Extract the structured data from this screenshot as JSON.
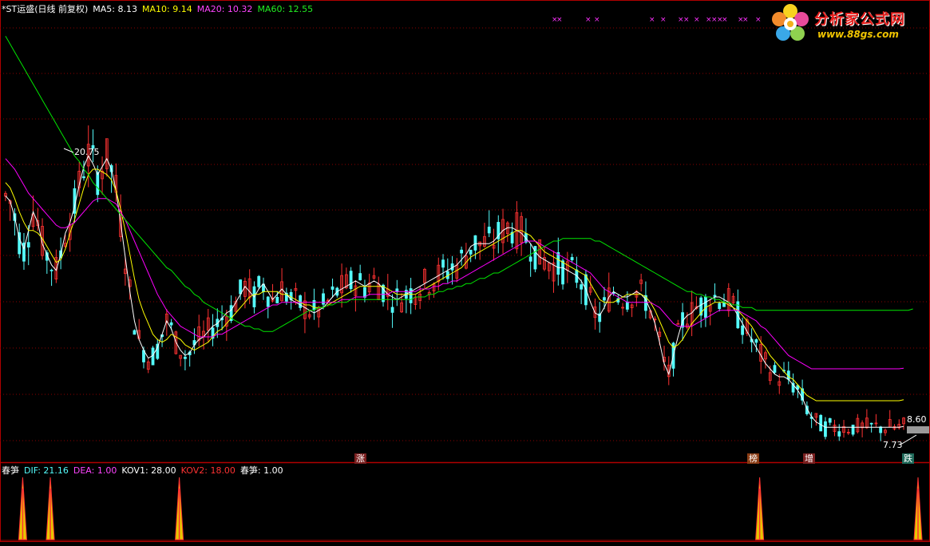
{
  "header": {
    "stock": "*ST运盛(日线 前复权)",
    "ma5": "MA5: 8.13",
    "ma10": "MA10: 9.14",
    "ma20": "MA20: 10.32",
    "ma60": "MA60: 12.55"
  },
  "indicator_header": {
    "name": "春笋",
    "dif": "DIF: 21.16",
    "dea": "DEA: 1.00",
    "kov1": "KOV1: 28.00",
    "kov2": "KOV2: 18.00",
    "chunsun": "春笋: 1.00"
  },
  "logo": {
    "title": "分析家公式网",
    "url": "www.88gs.com"
  },
  "markers": {
    "zhang": "涨",
    "bang": "榜",
    "zeng": "增",
    "die": "跌"
  },
  "colors": {
    "up": "#ff3232",
    "down": "#54fcfc",
    "ma5": "#ffffff",
    "ma10": "#ffff00",
    "ma20": "#ff00ff",
    "ma60": "#00e600",
    "grid": "#8b0000",
    "border": "#b00000"
  },
  "chart_data": {
    "type": "line",
    "price_labels": {
      "high": "20.75",
      "low": "7.73",
      "last": "8.60"
    },
    "ylim": [
      7.3,
      23.5
    ],
    "n_bars": 200,
    "series": [
      {
        "name": "MA5",
        "values": [
          16.8,
          16.6,
          16.0,
          15.2,
          14.8,
          15.5,
          16.2,
          15.8,
          15.0,
          14.6,
          14.2,
          14.0,
          14.6,
          15.4,
          15.8,
          16.4,
          17.2,
          17.9,
          18.3,
          18.0,
          17.6,
          17.9,
          18.2,
          17.8,
          17.0,
          15.8,
          14.5,
          13.2,
          12.1,
          11.4,
          11.0,
          10.7,
          10.8,
          11.1,
          11.6,
          12.1,
          11.8,
          11.3,
          11.0,
          10.8,
          10.9,
          11.2,
          11.4,
          11.5,
          11.7,
          11.9,
          12.0,
          12.2,
          12.4,
          12.5,
          12.8,
          13.1,
          13.4,
          13.2,
          13.0,
          13.3,
          13.5,
          13.2,
          12.9,
          13.1,
          13.3,
          13.1,
          12.9,
          12.8,
          12.7,
          12.6,
          12.5,
          12.4,
          12.5,
          12.6,
          12.8,
          13.0,
          13.2,
          13.3,
          13.4,
          13.5,
          13.6,
          13.5,
          13.4,
          13.5,
          13.6,
          13.5,
          13.3,
          13.1,
          13.0,
          12.9,
          13.0,
          13.1,
          13.2,
          13.3,
          13.4,
          13.5,
          13.6,
          13.7,
          13.8,
          13.9,
          14.0,
          14.1,
          14.2,
          14.4,
          14.6,
          14.9,
          15.0,
          15.0,
          15.0,
          15.0,
          15.1,
          15.3,
          15.5,
          15.6,
          15.6,
          15.5,
          15.4,
          15.2,
          15.0,
          14.7,
          14.5,
          14.4,
          14.3,
          14.2,
          14.1,
          14.1,
          14.0,
          13.9,
          13.8,
          13.6,
          13.3,
          12.8,
          12.4,
          12.3,
          12.6,
          13.0,
          13.2,
          13.1,
          13.0,
          13.0,
          13.1,
          13.2,
          13.1,
          12.9,
          12.5,
          12.0,
          11.3,
          10.5,
          10.1,
          10.8,
          11.5,
          12.1,
          12.3,
          12.4,
          12.6,
          12.7,
          12.8,
          12.9,
          13.0,
          13.0,
          12.9,
          12.8,
          12.6,
          12.3,
          12.0,
          11.7,
          11.4,
          11.1,
          10.8,
          10.5,
          10.3,
          10.1,
          10.0,
          10.0,
          9.9,
          9.7,
          9.5,
          9.2,
          8.8,
          8.5,
          8.3,
          8.2,
          8.1,
          8.1,
          8.1,
          8.1,
          8.1,
          8.1,
          8.1,
          8.1,
          8.1,
          8.1,
          8.1,
          8.1,
          8.1,
          8.1,
          8.1,
          8.1,
          8.1,
          8.13
        ]
      },
      {
        "name": "MA10",
        "values": [
          17.3,
          17.1,
          16.7,
          16.2,
          15.8,
          15.5,
          15.5,
          15.4,
          15.2,
          14.9,
          14.6,
          14.3,
          14.4,
          14.8,
          15.4,
          15.9,
          16.5,
          17.1,
          17.6,
          17.8,
          17.8,
          17.7,
          17.6,
          17.4,
          17.0,
          16.3,
          15.5,
          14.6,
          13.7,
          12.9,
          12.4,
          12.0,
          11.6,
          11.4,
          11.3,
          11.4,
          11.6,
          11.5,
          11.4,
          11.2,
          11.1,
          11.0,
          11.1,
          11.2,
          11.3,
          11.5,
          11.7,
          11.8,
          12.0,
          12.2,
          12.4,
          12.6,
          12.8,
          13.0,
          13.1,
          13.1,
          13.2,
          13.2,
          13.2,
          13.2,
          13.1,
          13.1,
          13.0,
          12.9,
          12.8,
          12.7,
          12.7,
          12.6,
          12.6,
          12.6,
          12.7,
          12.8,
          12.9,
          13.0,
          13.1,
          13.2,
          13.3,
          13.4,
          13.4,
          13.4,
          13.4,
          13.4,
          13.4,
          13.3,
          13.2,
          13.1,
          13.1,
          13.1,
          13.1,
          13.1,
          13.2,
          13.3,
          13.4,
          13.5,
          13.6,
          13.7,
          13.8,
          13.9,
          14.0,
          14.1,
          14.3,
          14.5,
          14.6,
          14.7,
          14.8,
          14.9,
          15.0,
          15.1,
          15.2,
          15.3,
          15.4,
          15.5,
          15.5,
          15.4,
          15.3,
          15.1,
          14.9,
          14.7,
          14.6,
          14.5,
          14.4,
          14.3,
          14.2,
          14.1,
          14.0,
          13.9,
          13.8,
          13.5,
          13.2,
          12.9,
          12.8,
          12.8,
          12.8,
          12.9,
          13.0,
          13.1,
          13.1,
          13.1,
          13.1,
          13.0,
          12.8,
          12.5,
          12.1,
          11.7,
          11.3,
          11.1,
          11.2,
          11.4,
          11.7,
          12.0,
          12.2,
          12.4,
          12.6,
          12.7,
          12.8,
          12.8,
          12.8,
          12.7,
          12.6,
          12.5,
          12.3,
          12.1,
          11.9,
          11.6,
          11.3,
          11.1,
          10.8,
          10.6,
          10.4,
          10.2,
          10.0,
          9.9,
          9.7,
          9.5,
          9.3,
          9.2,
          9.1,
          9.1,
          9.1,
          9.1,
          9.1,
          9.1,
          9.1,
          9.1,
          9.1,
          9.1,
          9.1,
          9.1,
          9.1,
          9.1,
          9.1,
          9.1,
          9.1,
          9.1,
          9.1,
          9.14
        ]
      },
      {
        "name": "MA20",
        "values": [
          18.2,
          18.0,
          17.8,
          17.5,
          17.2,
          16.9,
          16.7,
          16.5,
          16.3,
          16.1,
          15.9,
          15.7,
          15.6,
          15.6,
          15.7,
          15.8,
          16.0,
          16.2,
          16.4,
          16.6,
          16.7,
          16.7,
          16.7,
          16.6,
          16.5,
          16.2,
          15.9,
          15.5,
          15.1,
          14.7,
          14.3,
          13.9,
          13.5,
          13.1,
          12.8,
          12.5,
          12.3,
          12.1,
          11.9,
          11.8,
          11.7,
          11.6,
          11.5,
          11.5,
          11.5,
          11.5,
          11.6,
          11.6,
          11.7,
          11.8,
          11.9,
          12.0,
          12.1,
          12.2,
          12.3,
          12.4,
          12.5,
          12.6,
          12.7,
          12.7,
          12.8,
          12.8,
          12.8,
          12.8,
          12.8,
          12.8,
          12.8,
          12.8,
          12.8,
          12.8,
          12.8,
          12.8,
          12.8,
          12.9,
          12.9,
          12.9,
          13.0,
          13.0,
          13.0,
          13.1,
          13.1,
          13.1,
          13.1,
          13.1,
          13.2,
          13.2,
          13.2,
          13.2,
          13.2,
          13.2,
          13.3,
          13.3,
          13.3,
          13.4,
          13.4,
          13.5,
          13.5,
          13.6,
          13.6,
          13.7,
          13.8,
          13.9,
          14.0,
          14.1,
          14.2,
          14.3,
          14.4,
          14.5,
          14.6,
          14.7,
          14.8,
          14.9,
          15.0,
          15.1,
          15.1,
          15.1,
          15.0,
          14.9,
          14.8,
          14.7,
          14.6,
          14.5,
          14.4,
          14.3,
          14.2,
          14.1,
          14.0,
          13.9,
          13.7,
          13.5,
          13.3,
          13.2,
          13.1,
          13.0,
          12.9,
          12.8,
          12.8,
          12.8,
          12.8,
          12.8,
          12.8,
          12.7,
          12.6,
          12.4,
          12.2,
          12.0,
          11.9,
          11.9,
          11.9,
          11.9,
          12.0,
          12.1,
          12.2,
          12.3,
          12.4,
          12.5,
          12.5,
          12.5,
          12.5,
          12.5,
          12.4,
          12.3,
          12.2,
          12.1,
          11.9,
          11.8,
          11.6,
          11.4,
          11.2,
          11.0,
          10.8,
          10.7,
          10.6,
          10.5,
          10.4,
          10.3,
          10.3,
          10.3,
          10.3,
          10.3,
          10.3,
          10.3,
          10.3,
          10.3,
          10.3,
          10.3,
          10.3,
          10.3,
          10.3,
          10.3,
          10.3,
          10.3,
          10.3,
          10.3,
          10.3,
          10.32
        ]
      },
      {
        "name": "MA60",
        "values": [
          22.8,
          22.5,
          22.2,
          21.9,
          21.6,
          21.3,
          21.0,
          20.7,
          20.4,
          20.1,
          19.8,
          19.5,
          19.2,
          18.9,
          18.6,
          18.3,
          18.1,
          17.8,
          17.6,
          17.3,
          17.1,
          16.9,
          16.7,
          16.5,
          16.3,
          16.1,
          15.9,
          15.7,
          15.5,
          15.3,
          15.1,
          14.9,
          14.7,
          14.5,
          14.3,
          14.1,
          14.0,
          13.8,
          13.6,
          13.4,
          13.3,
          13.1,
          13.0,
          12.8,
          12.7,
          12.6,
          12.5,
          12.4,
          12.3,
          12.2,
          12.1,
          12.0,
          11.9,
          11.9,
          11.8,
          11.8,
          11.7,
          11.7,
          11.7,
          11.8,
          11.9,
          12.0,
          12.1,
          12.2,
          12.3,
          12.4,
          12.5,
          12.5,
          12.6,
          12.6,
          12.7,
          12.7,
          12.8,
          12.8,
          12.8,
          12.9,
          12.9,
          12.9,
          12.9,
          12.9,
          12.9,
          12.9,
          12.9,
          12.9,
          12.9,
          12.9,
          12.9,
          12.9,
          12.9,
          13.0,
          13.0,
          13.0,
          13.1,
          13.1,
          13.2,
          13.2,
          13.3,
          13.3,
          13.4,
          13.4,
          13.5,
          13.5,
          13.6,
          13.7,
          13.7,
          13.8,
          13.9,
          13.9,
          14.0,
          14.1,
          14.2,
          14.3,
          14.4,
          14.5,
          14.6,
          14.7,
          14.8,
          14.9,
          15.0,
          15.1,
          15.1,
          15.2,
          15.2,
          15.2,
          15.2,
          15.2,
          15.2,
          15.2,
          15.1,
          15.1,
          15.0,
          14.9,
          14.8,
          14.7,
          14.6,
          14.5,
          14.4,
          14.3,
          14.2,
          14.1,
          14.0,
          13.9,
          13.8,
          13.7,
          13.6,
          13.5,
          13.4,
          13.3,
          13.2,
          13.2,
          13.1,
          13.1,
          13.0,
          13.0,
          12.9,
          12.9,
          12.8,
          12.8,
          12.7,
          12.7,
          12.6,
          12.6,
          12.6,
          12.5,
          12.5,
          12.5,
          12.5,
          12.5,
          12.5,
          12.5,
          12.5,
          12.5,
          12.5,
          12.5,
          12.5,
          12.5,
          12.5,
          12.5,
          12.5,
          12.5,
          12.5,
          12.5,
          12.5,
          12.5,
          12.5,
          12.5,
          12.5,
          12.5,
          12.5,
          12.5,
          12.5,
          12.5,
          12.5,
          12.5,
          12.5,
          12.5,
          12.5,
          12.55
        ]
      }
    ],
    "indicator_spikes": [
      2,
      8,
      36,
      162,
      199
    ]
  }
}
